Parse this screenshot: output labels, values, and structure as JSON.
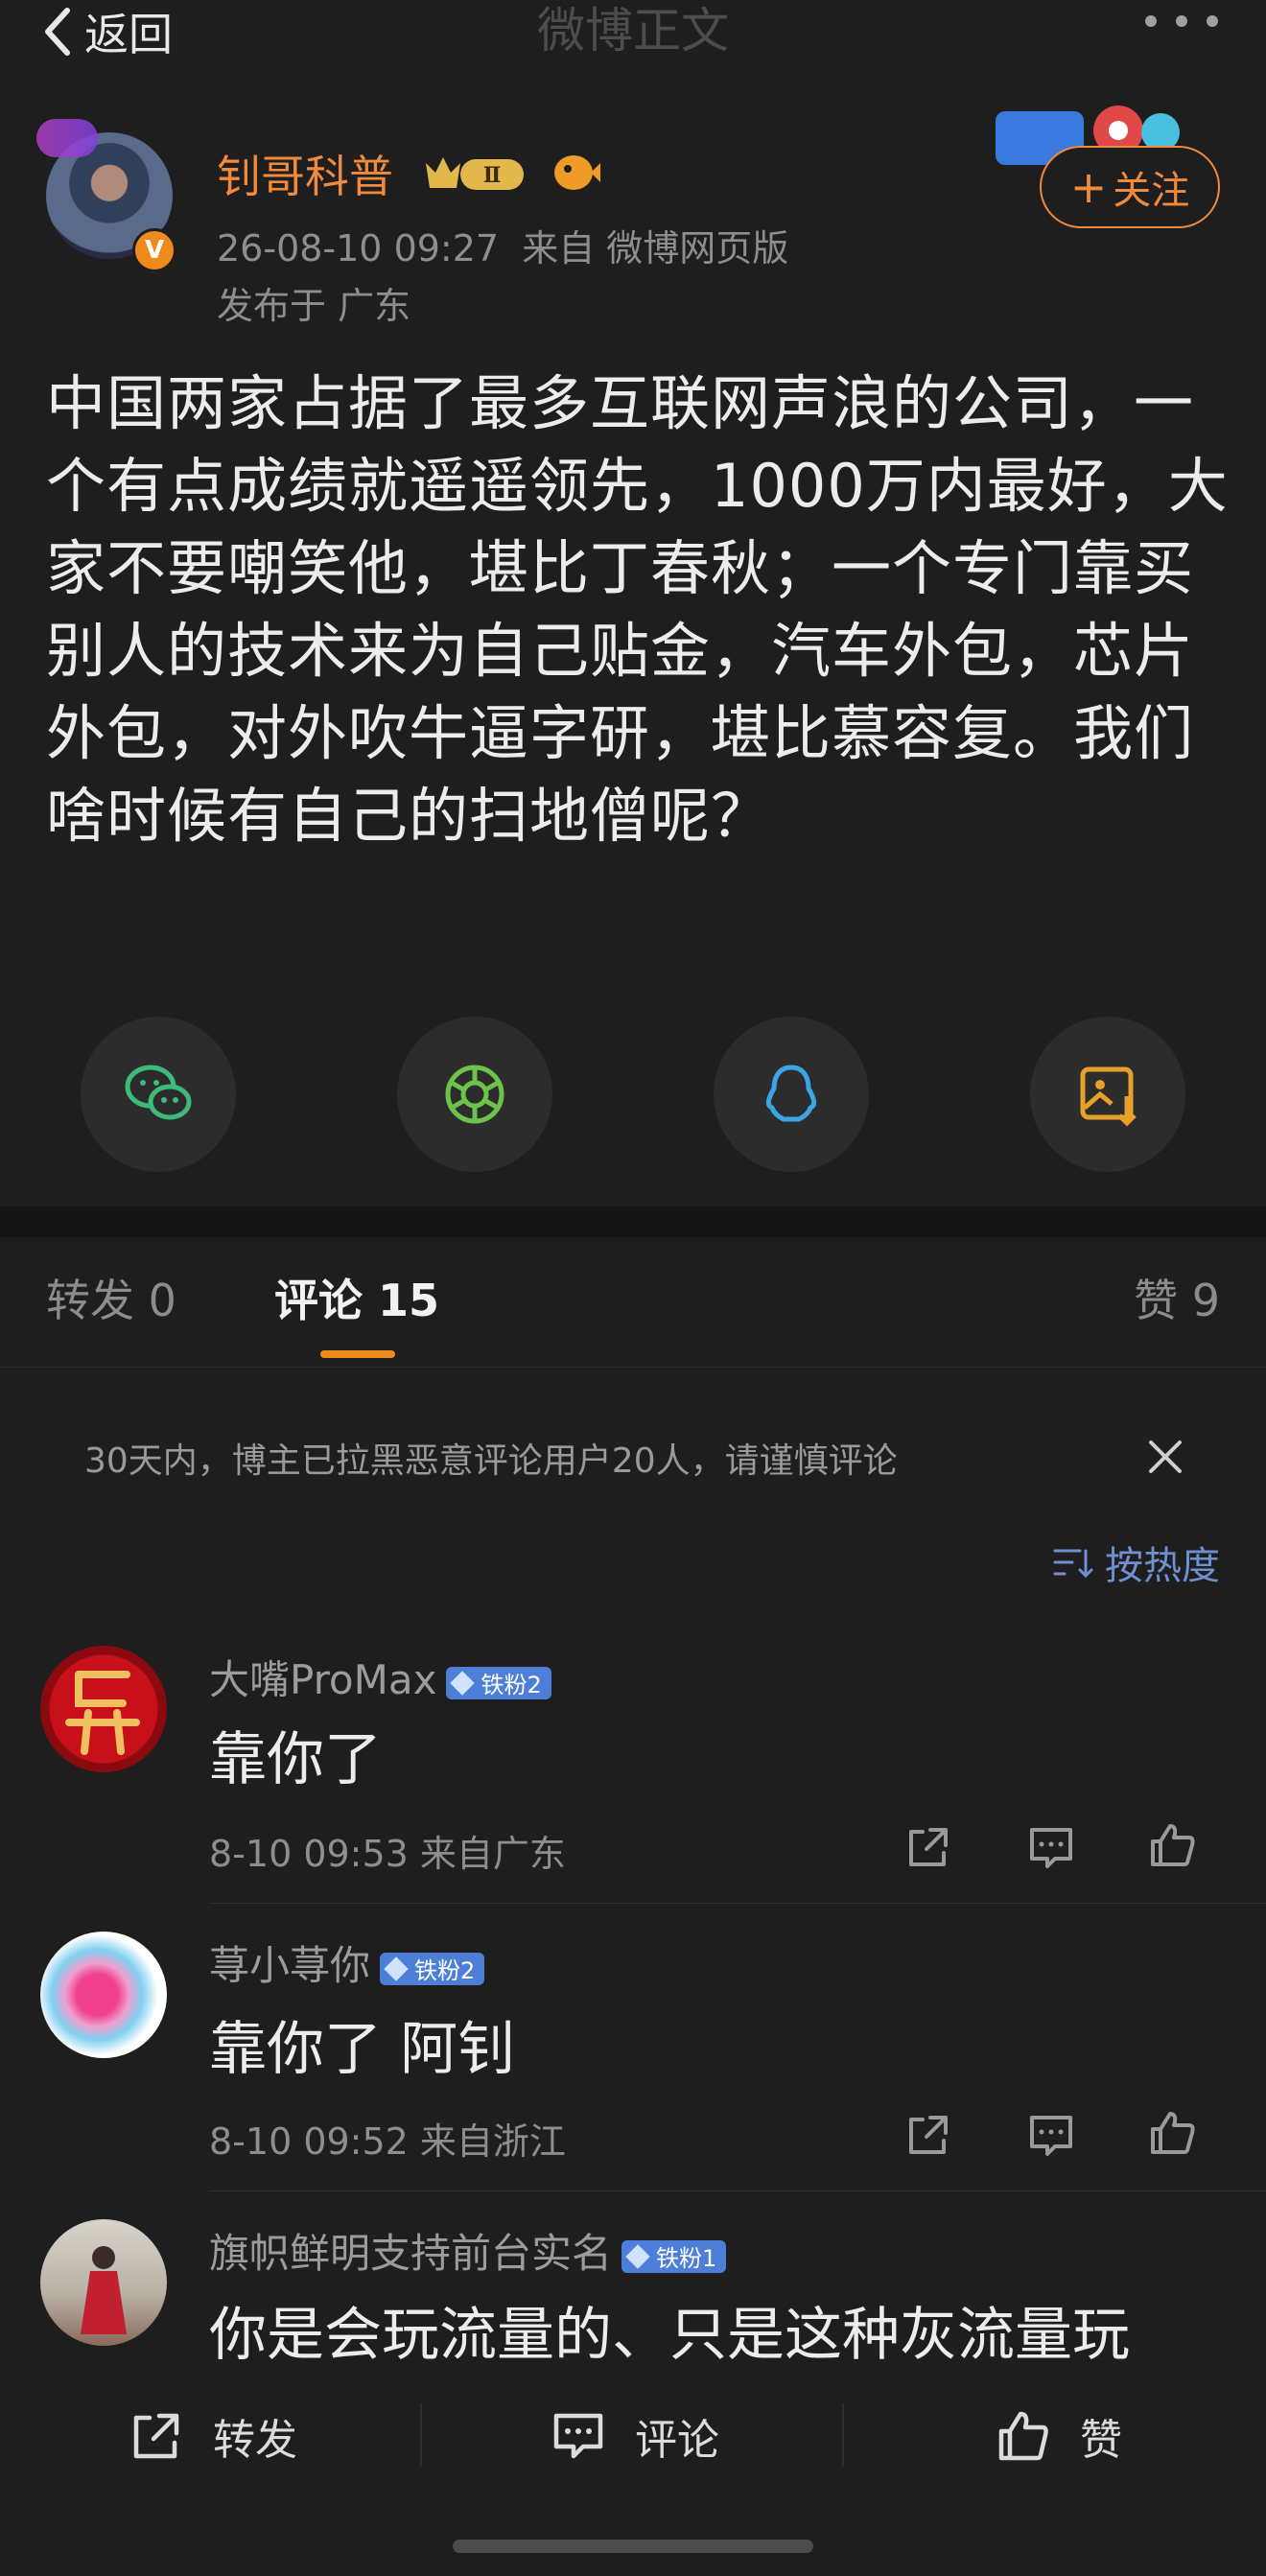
{
  "header": {
    "back_label": "返回",
    "title": "微博正文"
  },
  "author": {
    "name": "钊哥科普",
    "vip_level": "Ⅱ",
    "meta": "26-08-10 09:27  来自 微博网页版",
    "location": "发布于 广东",
    "follow_label": "关注",
    "follow_plus": "+",
    "verified_mark": "V"
  },
  "post": {
    "text": "中国两家占据了最多互联网声浪的公司，一个有点成绩就遥遥领先，1000万内最好，大家不要嘲笑他，堪比丁春秋；一个专门靠买别人的技术来为自己贴金，汽车外包，芯片外包，对外吹牛逼字研，堪比慕容复。我们啥时候有自己的扫地僧呢？"
  },
  "share": {
    "icons": [
      "wechat-icon",
      "moments-icon",
      "qq-icon",
      "save-image-icon"
    ],
    "colors": {
      "wechat": "#3dbb7a",
      "moments": "#6cc24a",
      "qq": "#3aa6e6",
      "save": "#e8a02a"
    }
  },
  "tabs": {
    "repost": "转发 0",
    "comment": "评论 15",
    "like": "赞 9"
  },
  "notice": {
    "text": "30天内，博主已拉黑恶意评论用户20人，请谨慎评论"
  },
  "sort": {
    "label": "按热度"
  },
  "comments": [
    {
      "name": "大嘴ProMax",
      "badge": "铁粉2",
      "text": "靠你了",
      "time": "8-10 09:53 来自广东"
    },
    {
      "name": "荨小荨你",
      "badge": "铁粉2",
      "text": "靠你了 阿钊",
      "time": "8-10 09:52 来自浙江"
    },
    {
      "name": "旗帜鲜明支持前台实名",
      "badge": "铁粉1",
      "text": "你是会玩流量的、只是这种灰流量玩"
    }
  ],
  "bottom_bar": {
    "repost": "转发",
    "comment": "评论",
    "like": "赞"
  },
  "colors": {
    "accent": "#f08a3c",
    "badge_blue": "#4d7fd8",
    "sort_blue": "#6f8fd0",
    "underline": "#f08a1c"
  }
}
